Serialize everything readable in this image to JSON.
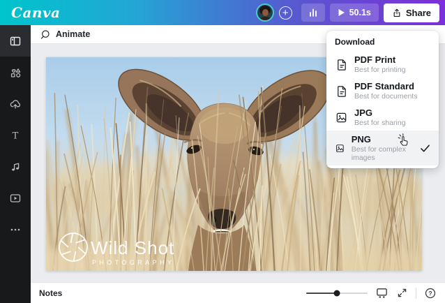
{
  "topbar": {
    "logo": "Canva",
    "duration": "50.1s",
    "share_label": "Share",
    "icons": [
      "avatar",
      "plus-icon",
      "bar-chart-icon",
      "play-icon",
      "share-upload-icon"
    ]
  },
  "sidebar": {
    "items": [
      {
        "icon": "templates-icon",
        "active": true
      },
      {
        "icon": "elements-icon",
        "active": false
      },
      {
        "icon": "uploads-icon",
        "active": false
      },
      {
        "icon": "text-icon",
        "active": false
      },
      {
        "icon": "audio-icon",
        "active": false
      },
      {
        "icon": "videos-icon",
        "active": false
      },
      {
        "icon": "more-icon",
        "active": false
      }
    ]
  },
  "toolbar": {
    "animate_label": "Animate",
    "animate_icon": "animate-icon"
  },
  "download_menu": {
    "title": "Download",
    "items": [
      {
        "label": "PDF Print",
        "description": "Best for printing",
        "icon": "document-icon",
        "selected": false
      },
      {
        "label": "PDF Standard",
        "description": "Best for documents",
        "icon": "document-icon",
        "selected": false
      },
      {
        "label": "JPG",
        "description": "Best for sharing",
        "icon": "image-icon",
        "selected": false
      },
      {
        "label": "PNG",
        "description": "Best for complex images",
        "icon": "image-icon",
        "selected": true
      }
    ],
    "selected_indicator": "check-icon",
    "cursor": "pointer-hand-cursor"
  },
  "canvas": {
    "watermark_line1": "Wild Shot",
    "watermark_line2": "PHOTOGRAPHY",
    "photo_subject": "kudu antelope with large ears in tall dry grass"
  },
  "bottombar": {
    "notes_label": "Notes",
    "zoom_slider_position": "50%",
    "icons": [
      "grid-view-icon",
      "fullscreen-icon",
      "help-icon"
    ]
  },
  "colors": {
    "brand_gradient_start": "#00c4cc",
    "brand_gradient_end": "#7d2fd9",
    "accent_teal": "#00c4cc",
    "sidebar_bg": "#18191b",
    "canvas_bg": "#ebecf0"
  }
}
